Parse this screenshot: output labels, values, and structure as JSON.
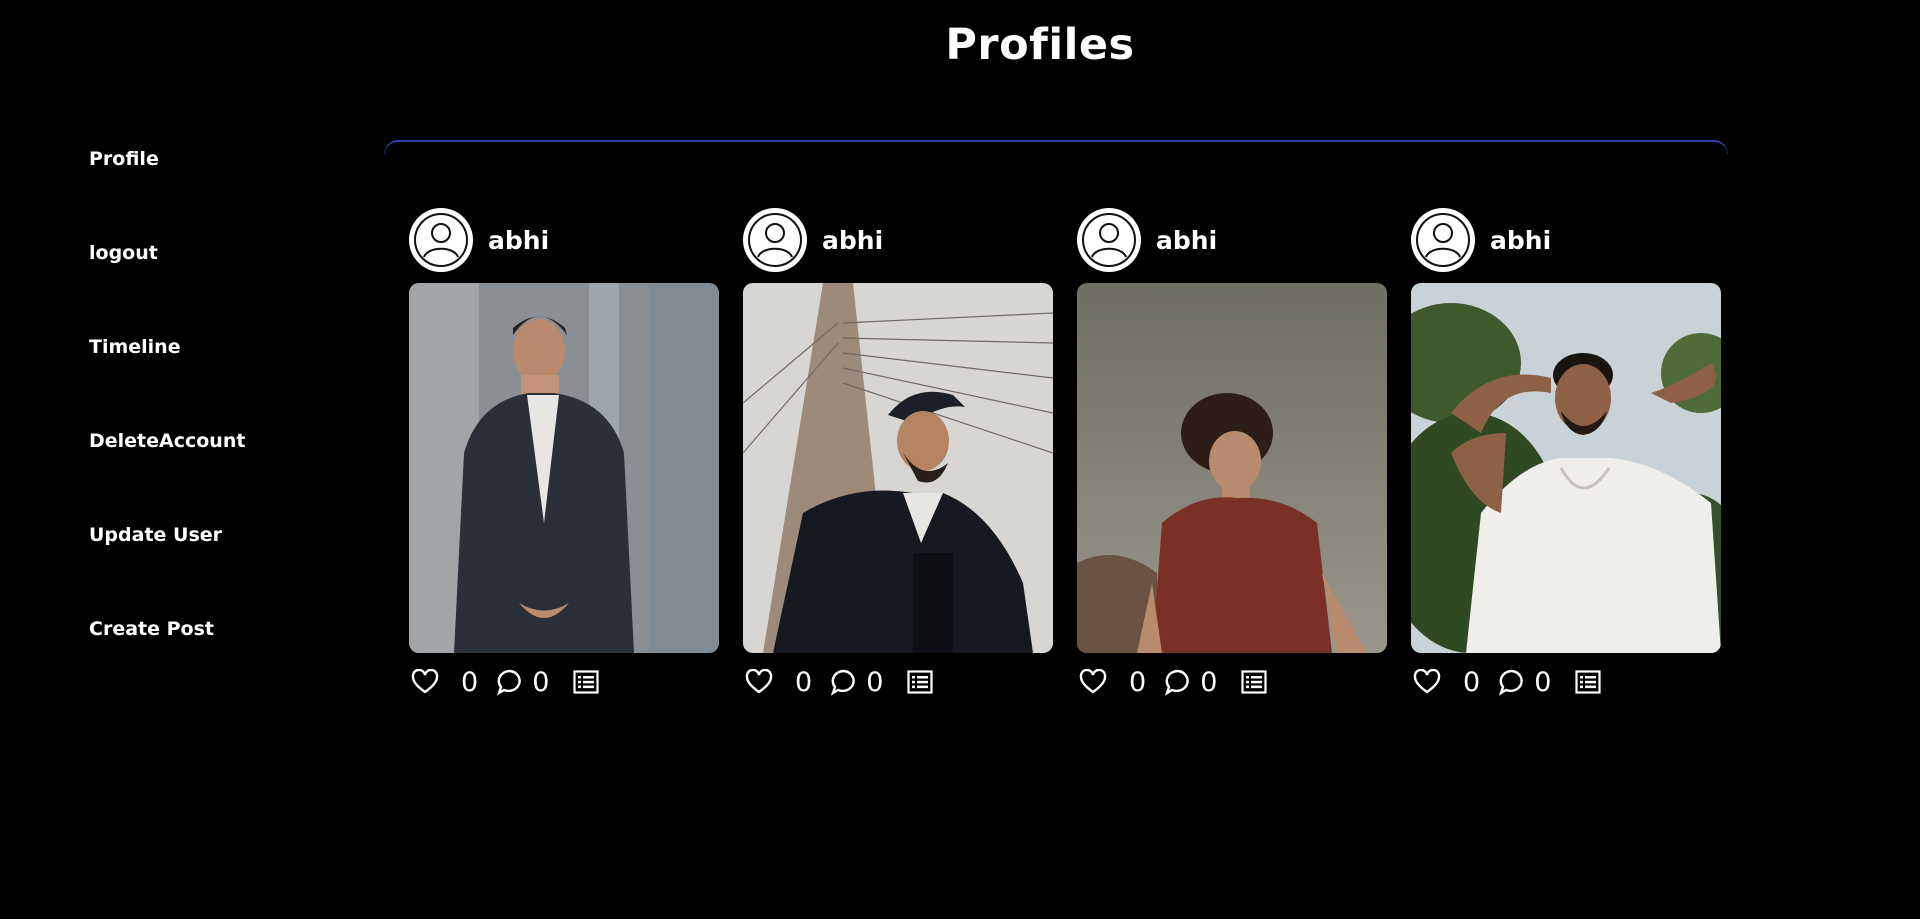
{
  "header": {
    "title": "Profiles"
  },
  "sidebar": {
    "items": [
      {
        "label": "Profile"
      },
      {
        "label": "logout"
      },
      {
        "label": "Timeline"
      },
      {
        "label": "DeleteAccount"
      },
      {
        "label": "Update User"
      },
      {
        "label": "Create Post"
      }
    ]
  },
  "colors": {
    "background": "#000000",
    "text": "#ffffff",
    "divider": "#2a3fa8"
  },
  "posts": [
    {
      "username": "abhi",
      "likes": "0",
      "comments": "0",
      "photo_icon": "photo-man-in-suit"
    },
    {
      "username": "abhi",
      "likes": "0",
      "comments": "0",
      "photo_icon": "photo-man-in-cap-bridge"
    },
    {
      "username": "abhi",
      "likes": "0",
      "comments": "0",
      "photo_icon": "photo-man-red-shirt"
    },
    {
      "username": "abhi",
      "likes": "0",
      "comments": "0",
      "photo_icon": "photo-man-white-tshirt"
    }
  ],
  "icons": {
    "avatar": "user-circle-icon",
    "like": "heart-icon",
    "comment": "comment-bubble-icon",
    "details": "list-icon"
  }
}
